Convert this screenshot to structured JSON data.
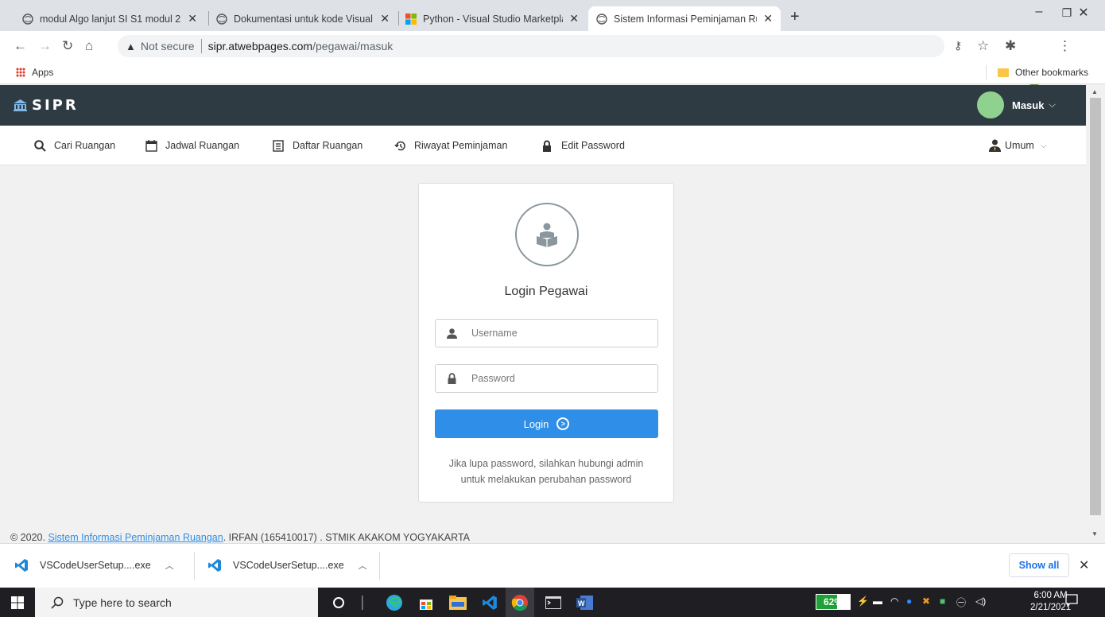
{
  "browser": {
    "tabs": [
      {
        "title": "modul Algo lanjut SI S1 modul 2",
        "active": false
      },
      {
        "title": "Dokumentasi untuk kode Visual S",
        "active": false
      },
      {
        "title": "Python - Visual Studio Marketpla",
        "active": false
      },
      {
        "title": "Sistem Informasi Peminjaman Ru",
        "active": true
      }
    ],
    "new_tab_symbol": "+",
    "security_label": "Not secure",
    "url_host": "sipr.atwebpages.com",
    "url_path": "/pegawai/masuk",
    "bookmarks": {
      "apps_label": "Apps",
      "other_label": "Other bookmarks"
    }
  },
  "app": {
    "brand": "SIPR",
    "user_menu_label": "Masuk",
    "menu": [
      {
        "label": "Cari Ruangan",
        "icon": "search-icon"
      },
      {
        "label": "Jadwal Ruangan",
        "icon": "calendar-icon"
      },
      {
        "label": "Daftar Ruangan",
        "icon": "list-icon"
      },
      {
        "label": "Riwayat Peminjaman",
        "icon": "history-icon"
      },
      {
        "label": "Edit Password",
        "icon": "lock-icon"
      }
    ],
    "role_label": "Umum"
  },
  "login": {
    "title": "Login Pegawai",
    "username_placeholder": "Username",
    "password_placeholder": "Password",
    "button_label": "Login",
    "note_line1": "Jika lupa password, silahkan hubungi admin",
    "note_line2": "untuk melakukan perubahan password"
  },
  "footer": {
    "prefix": "© 2020. ",
    "link": "Sistem Informasi Peminjaman Ruangan",
    "suffix": ". IRFAN (165410017) . STMIK AKAKOM YOGYAKARTA"
  },
  "downloads": {
    "items": [
      "VSCodeUserSetup....exe",
      "VSCodeUserSetup....exe"
    ],
    "show_all_label": "Show all"
  },
  "taskbar": {
    "search_placeholder": "Type here to search",
    "battery_percent": "62%",
    "time": "6:00 AM",
    "date": "2/21/2021"
  },
  "colors": {
    "appbar": "#2f3b42",
    "accent": "#2f8fe8",
    "avatar": "#8fd18f"
  }
}
